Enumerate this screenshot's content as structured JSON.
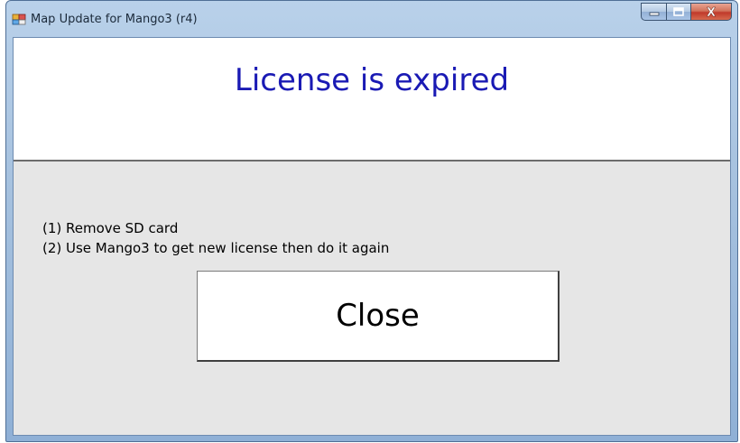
{
  "window": {
    "title": "Map Update for Mango3 (r4)",
    "app_icon": "app-icon"
  },
  "caption_buttons": {
    "minimize_icon": "minimize-icon",
    "maximize_icon": "maximize-icon",
    "close_icon": "close-icon",
    "close_glyph": "X"
  },
  "header": {
    "title": "License is expired",
    "title_color": "#1a1ab4"
  },
  "instructions": [
    "(1) Remove SD card",
    "(2) Use Mango3 to get new license then do it again"
  ],
  "close_button": {
    "label": "Close"
  }
}
